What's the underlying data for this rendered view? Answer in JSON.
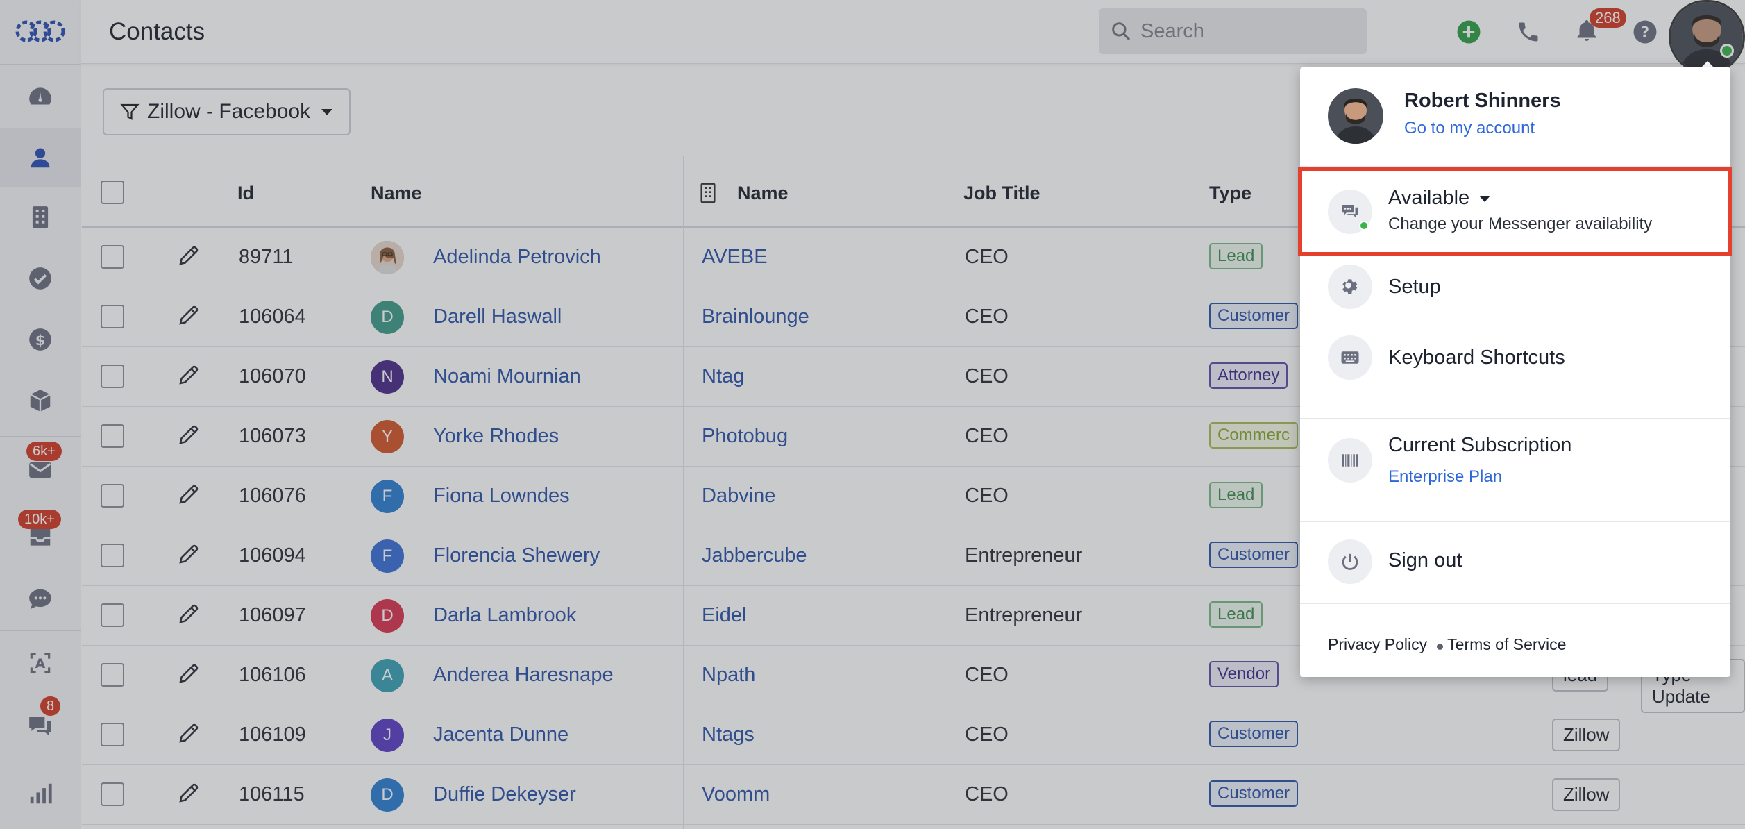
{
  "header": {
    "title": "Contacts",
    "search_placeholder": "Search",
    "notifications_count": "268"
  },
  "sidebar": {
    "badges": {
      "email": "6k+",
      "inbox": "10k+",
      "chat": "8"
    }
  },
  "filter": {
    "label": "Zillow - Facebook"
  },
  "table": {
    "columns": [
      "Id",
      "Name",
      "Name",
      "Job Title",
      "Type"
    ],
    "rows": [
      {
        "id": "89711",
        "name": "Adelinda Petrovich",
        "initial": "",
        "avatar_color": "#b08a6a",
        "company": "AVEBE",
        "job": "CEO",
        "type": "Lead",
        "type_class": "lead",
        "tags": []
      },
      {
        "id": "106064",
        "name": "Darell Haswall",
        "initial": "D",
        "avatar_color": "#3f9a8a",
        "company": "Brainlounge",
        "job": "CEO",
        "type": "Customer",
        "type_class": "customer",
        "tags": []
      },
      {
        "id": "106070",
        "name": "Noami Mournian",
        "initial": "N",
        "avatar_color": "#4a2c8a",
        "company": "Ntag",
        "job": "CEO",
        "type": "Attorney",
        "type_class": "attorney",
        "tags": []
      },
      {
        "id": "106073",
        "name": "Yorke Rhodes",
        "initial": "Y",
        "avatar_color": "#d4562a",
        "company": "Photobug",
        "job": "CEO",
        "type": "Commerc",
        "type_class": "commercial",
        "tags": []
      },
      {
        "id": "106076",
        "name": "Fiona Lowndes",
        "initial": "F",
        "avatar_color": "#2f7fd2",
        "company": "Dabvine",
        "job": "CEO",
        "type": "Lead",
        "type_class": "lead",
        "tags": []
      },
      {
        "id": "106094",
        "name": "Florencia Shewery",
        "initial": "F",
        "avatar_color": "#3b6fd6",
        "company": "Jabbercube",
        "job": "Entrepreneur",
        "type": "Customer",
        "type_class": "customer",
        "tags": []
      },
      {
        "id": "106097",
        "name": "Darla Lambrook",
        "initial": "D",
        "avatar_color": "#d9344f",
        "company": "Eidel",
        "job": "Entrepreneur",
        "type": "Lead",
        "type_class": "lead",
        "tags": []
      },
      {
        "id": "106106",
        "name": "Anderea Haresnape",
        "initial": "A",
        "avatar_color": "#3aa1b4",
        "company": "Npath",
        "job": "CEO",
        "type": "Vendor",
        "type_class": "vendor",
        "tags": [
          "lead",
          "Type Update"
        ]
      },
      {
        "id": "106109",
        "name": "Jacenta Dunne",
        "initial": "J",
        "avatar_color": "#5b3fc4",
        "company": "Ntags",
        "job": "CEO",
        "type": "Customer",
        "type_class": "customer",
        "tags": [
          "Zillow"
        ]
      },
      {
        "id": "106115",
        "name": "Duffie Dekeyser",
        "initial": "D",
        "avatar_color": "#2f7fd2",
        "company": "Voomm",
        "job": "CEO",
        "type": "Customer",
        "type_class": "customer",
        "tags": [
          "Zillow"
        ]
      }
    ]
  },
  "menu": {
    "user_name": "Robert Shinners",
    "account_link": "Go to my account",
    "availability_label": "Available",
    "availability_sub": "Change your Messenger availability",
    "setup": "Setup",
    "shortcuts": "Keyboard Shortcuts",
    "subscription": "Current Subscription",
    "plan": "Enterprise Plan",
    "sign_out": "Sign out",
    "privacy": "Privacy Policy",
    "terms": "Terms of Service"
  },
  "colors": {
    "accent": "#2c52a8",
    "link": "#2d67d8",
    "highlight": "#e4402d",
    "status_online": "#3ab54a",
    "badge_red": "#d23b25"
  }
}
